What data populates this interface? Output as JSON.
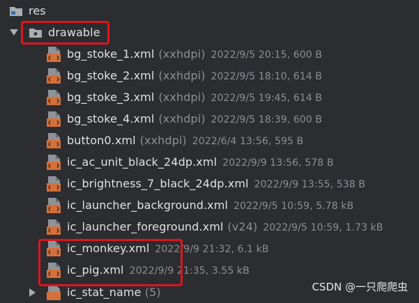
{
  "tree": {
    "root": {
      "label": "res"
    },
    "folder": {
      "label": "drawable",
      "expanded": true
    },
    "files": [
      {
        "name": "bg_stoke_1.xml",
        "qualifier": "(xxhdpi)",
        "meta": "2022/9/5 20:15, 600 B"
      },
      {
        "name": "bg_stoke_2.xml",
        "qualifier": "(xxhdpi)",
        "meta": "2022/9/5 18:10, 614 B"
      },
      {
        "name": "bg_stoke_3.xml",
        "qualifier": "(xxhdpi)",
        "meta": "2022/9/5 19:45, 614 B"
      },
      {
        "name": "bg_stoke_4.xml",
        "qualifier": "(xxhdpi)",
        "meta": "2022/9/5 18:39, 600 B"
      },
      {
        "name": "button0.xml",
        "qualifier": "(xxhdpi)",
        "meta": "2022/6/4 13:56, 595 B"
      },
      {
        "name": "ic_ac_unit_black_24dp.xml",
        "qualifier": "",
        "meta": "2022/9/9 13:56, 578 B"
      },
      {
        "name": "ic_brightness_7_black_24dp.xml",
        "qualifier": "",
        "meta": "2022/9/9 13:55, 538 B"
      },
      {
        "name": "ic_launcher_background.xml",
        "qualifier": "",
        "meta": "2022/9/5 10:59, 5.78 kB"
      },
      {
        "name": "ic_launcher_foreground.xml",
        "qualifier": "(v24)",
        "meta": "2022/9/5 10:59, 1.73 kB"
      },
      {
        "name": "ic_monkey.xml",
        "qualifier": "",
        "meta": "2022/9/9 21:32, 6.1 kB"
      },
      {
        "name": "ic_pig.xml",
        "qualifier": "",
        "meta": "2022/9/9 21:35, 3.55 kB"
      }
    ],
    "collapsed_item": {
      "name": "ic_stat_name",
      "qualifier": "(5)"
    }
  },
  "watermark": "CSDN @一只爬爬虫",
  "colors": {
    "background": "#2b2d30",
    "highlight": "#e0141e",
    "xml_icon": "#d6703a",
    "folder_icon": "#a8adb3"
  }
}
